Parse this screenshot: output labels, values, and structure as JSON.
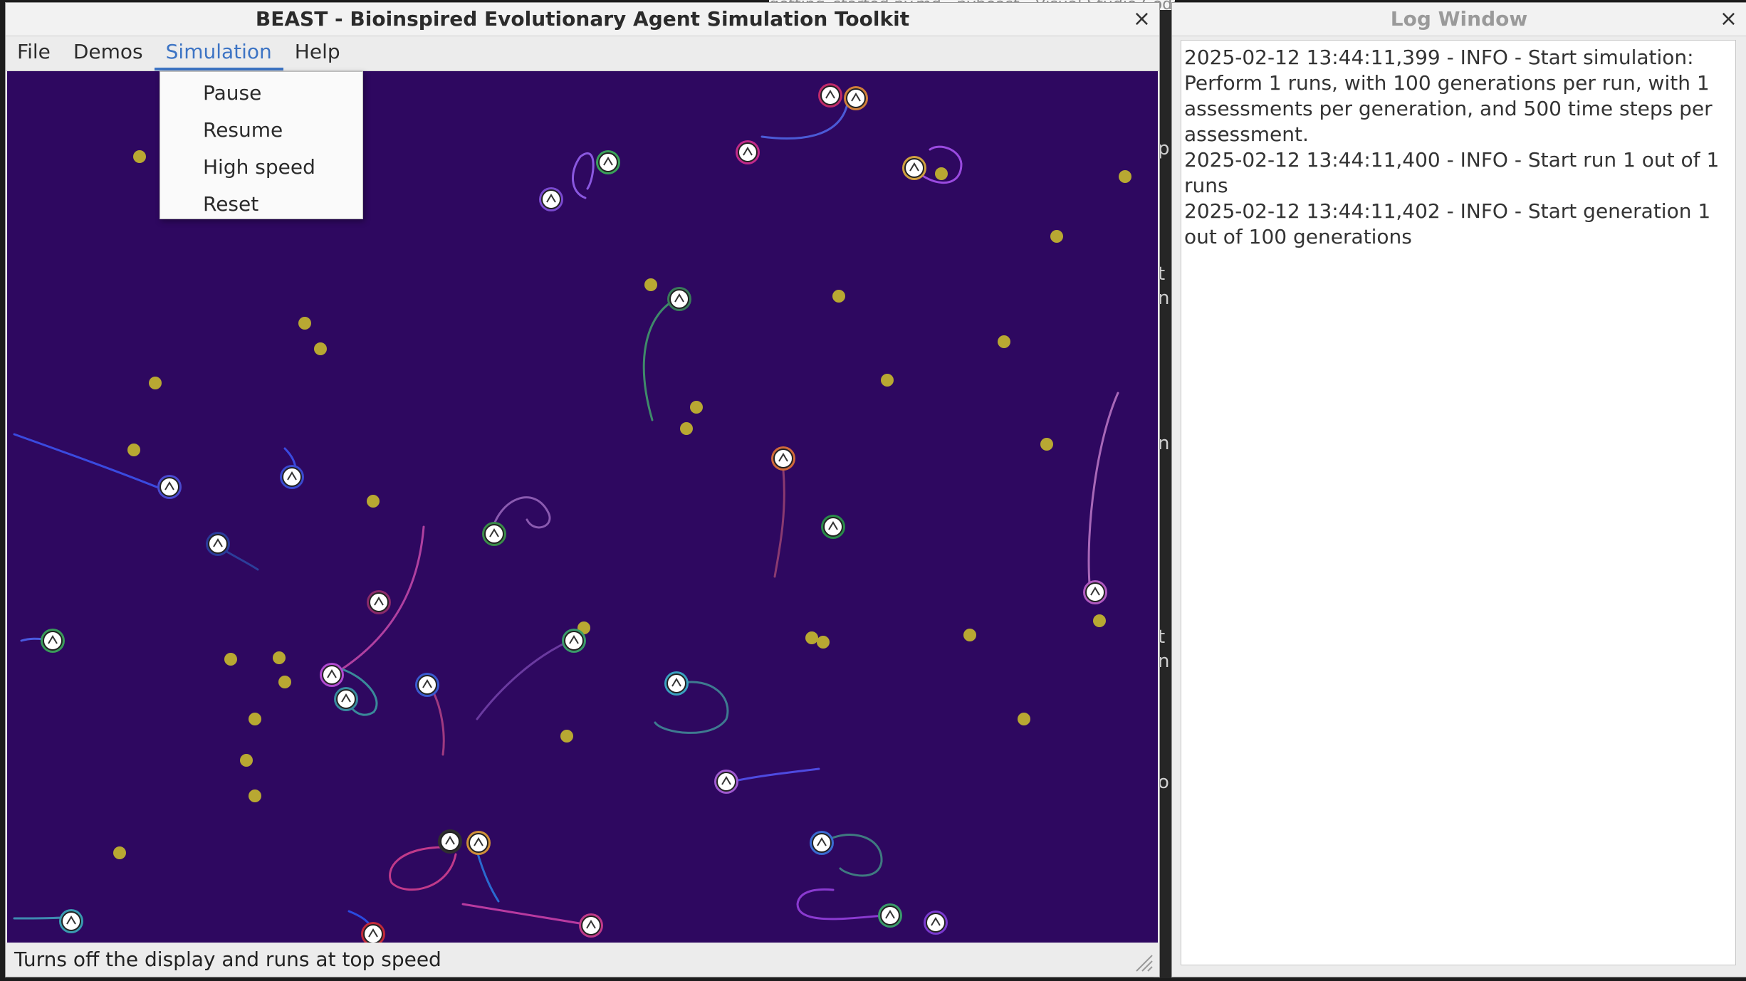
{
  "main_window": {
    "title": "BEAST - Bioinspired Evolutionary Agent Simulation Toolkit",
    "close_glyph": "×",
    "menus": [
      "File",
      "Demos",
      "Simulation",
      "Help"
    ],
    "active_menu": "Simulation",
    "simulation_menu_items": [
      "Pause",
      "Resume",
      "High speed",
      "Reset"
    ],
    "status_text": "Turns off the display and runs at top speed",
    "sim_background": "#2e0860",
    "food_color": "#b8a832"
  },
  "log_window": {
    "title": "Log Window",
    "close_glyph": "×",
    "entries": [
      "2025-02-12 13:44:11,399 - INFO - Start simulation: Perform 1 runs, with 100 generations per run, with 1 assessments per generation, and 500 time steps per assessment.",
      "2025-02-12 13:44:11,400 - INFO - Start run 1 out of 1 runs",
      "2025-02-12 13:44:11,402 - INFO - Start generation 1 out of 100 generations"
    ]
  },
  "background_app": {
    "title_fragment": "getting_started.py.md - pybeast - Visual Studio Code",
    "letters": [
      "p",
      "t",
      "n",
      "n",
      "t",
      "n",
      "o"
    ]
  }
}
